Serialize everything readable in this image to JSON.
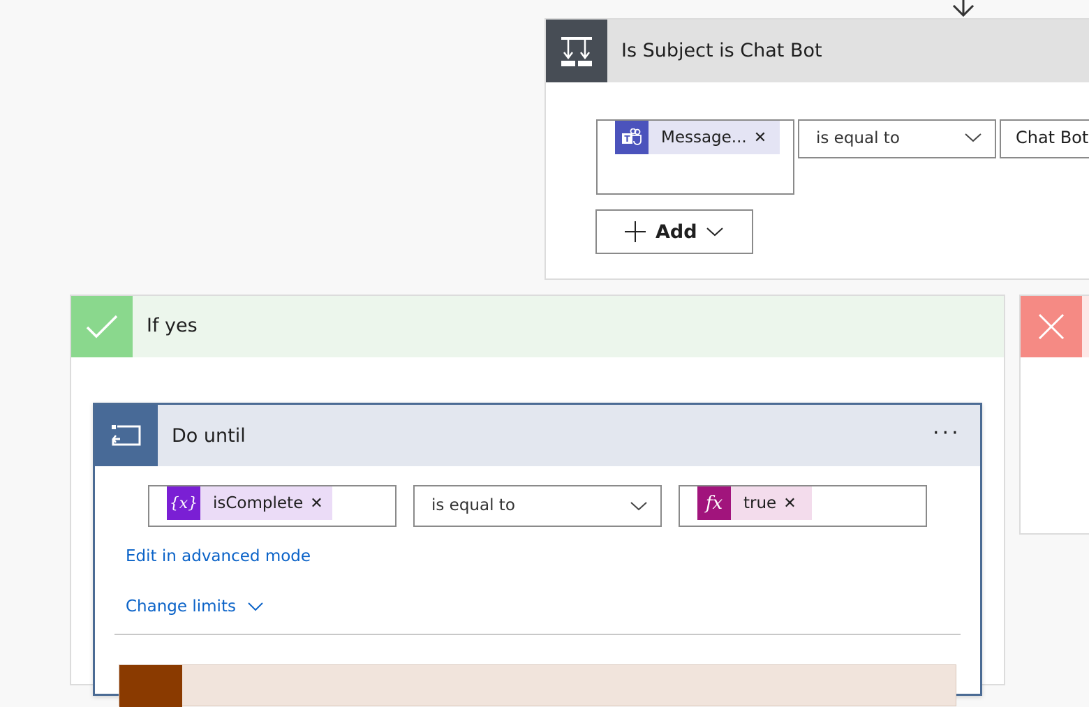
{
  "condition": {
    "title": "Is Subject is Chat Bot",
    "left_token": "Message...",
    "operator": "is equal to",
    "value": "Chat Bot",
    "add_label": "Add"
  },
  "if_yes": {
    "title": "If yes"
  },
  "do_until": {
    "title": "Do until",
    "more": "···",
    "left_token": "isComplete",
    "operator": "is equal to",
    "right_token": "true",
    "edit_advanced": "Edit in advanced mode",
    "change_limits": "Change limits"
  },
  "icons": {
    "condition": "condition-icon",
    "teams": "teams-icon",
    "variable": "variable-icon",
    "expression": "expression-icon",
    "check": "check-icon",
    "close": "close-icon",
    "loop": "loop-icon",
    "chevron": "chevron-down-icon",
    "plus": "plus-icon",
    "arrow": "arrow-down-icon"
  },
  "colors": {
    "condition_header": "#474d55",
    "teams": "#4b53bc",
    "if_yes": "#8ad88d",
    "if_no": "#f58a84",
    "do_until": "#486a97",
    "variable": "#7a1fd4",
    "expression": "#a1147c",
    "link": "#0b63c8"
  }
}
